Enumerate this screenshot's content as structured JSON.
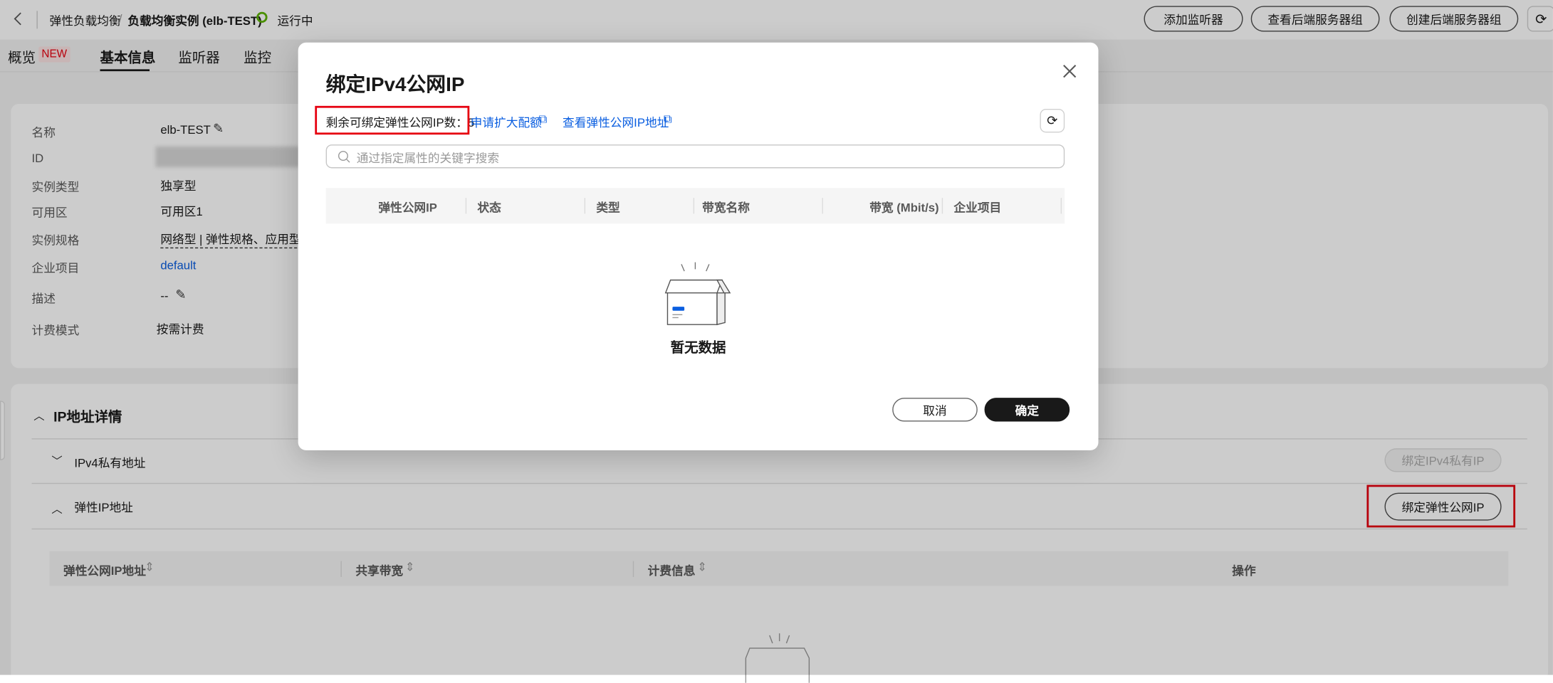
{
  "header": {
    "breadcrumb_root": "弹性负载均衡",
    "breadcrumb_sep": "/",
    "breadcrumb_current": "负载均衡实例 (elb-TEST)",
    "status": "运行中",
    "status_color": "#5cb300",
    "buttons": [
      "添加监听器",
      "查看后端服务器组",
      "创建后端服务器组"
    ]
  },
  "tabs": [
    {
      "label": "概览",
      "badge": "NEW"
    },
    {
      "label": "基本信息",
      "active": true
    },
    {
      "label": "监听器"
    },
    {
      "label": "监控"
    }
  ],
  "basic_info": {
    "rows": [
      {
        "label": "名称",
        "value": "elb-TEST"
      },
      {
        "label": "ID",
        "value": ""
      },
      {
        "label": "实例类型",
        "value": "独享型"
      },
      {
        "label": "可用区",
        "value": "可用区1"
      },
      {
        "label": "实例规格",
        "value": "网络型 | 弹性规格、应用型 |"
      },
      {
        "label": "企业项目",
        "value": "default"
      },
      {
        "label": "描述",
        "value": "--"
      },
      {
        "label": "计费模式",
        "value": "按需计费"
      }
    ]
  },
  "ip_section": {
    "title": "IP地址详情",
    "ipv4_private": "IPv4私有地址",
    "ipv4_private_button": "绑定IPv4私有IP",
    "eip": "弹性IP地址",
    "eip_button": "绑定弹性公网IP",
    "columns": [
      "弹性公网IP地址",
      "共享带宽",
      "计费信息",
      "操作"
    ]
  },
  "modal": {
    "title": "绑定IPv4公网IP",
    "remaining": "剩余可绑定弹性公网IP数：5",
    "link_quota": "申请扩大配额",
    "link_view": "查看弹性公网IP地址",
    "search_placeholder": "通过指定属性的关键字搜索",
    "columns": [
      "弹性公网IP",
      "状态",
      "类型",
      "带宽名称",
      "带宽 (Mbit/s)",
      "企业项目"
    ],
    "empty": "暂无数据",
    "cancel": "取消",
    "confirm": "确定"
  },
  "colors": {
    "link": "#0a5ee0",
    "highlight": "#e6000f"
  }
}
